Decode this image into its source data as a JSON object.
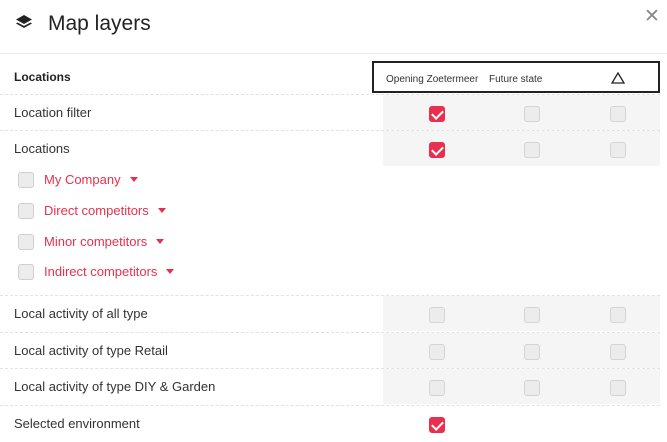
{
  "header": {
    "title": "Map layers",
    "layers_icon": "layers-icon",
    "close_label": "✕"
  },
  "columns": {
    "section_label": "Locations",
    "col1": "Opening Zoetermeer",
    "col2": "Future state",
    "col3_icon": "warning-triangle-icon"
  },
  "accent_color": "#e8304e",
  "rows": [
    {
      "label": "Location filter",
      "checks": [
        true,
        false,
        false
      ]
    },
    {
      "label": "Locations",
      "checks": [
        true,
        false,
        false
      ]
    },
    {
      "label": "Local activity of all type",
      "checks": [
        false,
        false,
        false
      ]
    },
    {
      "label": "Local activity of type Retail",
      "checks": [
        false,
        false,
        false
      ]
    },
    {
      "label": "Local activity of type DIY & Garden",
      "checks": [
        false,
        false,
        false
      ]
    },
    {
      "label": "Selected environment",
      "checks": [
        true
      ]
    }
  ],
  "sub_items": [
    {
      "label": "My Company",
      "checked": false
    },
    {
      "label": "Direct competitors",
      "checked": false
    },
    {
      "label": "Minor competitors",
      "checked": false
    },
    {
      "label": "Indirect competitors",
      "checked": false
    }
  ]
}
